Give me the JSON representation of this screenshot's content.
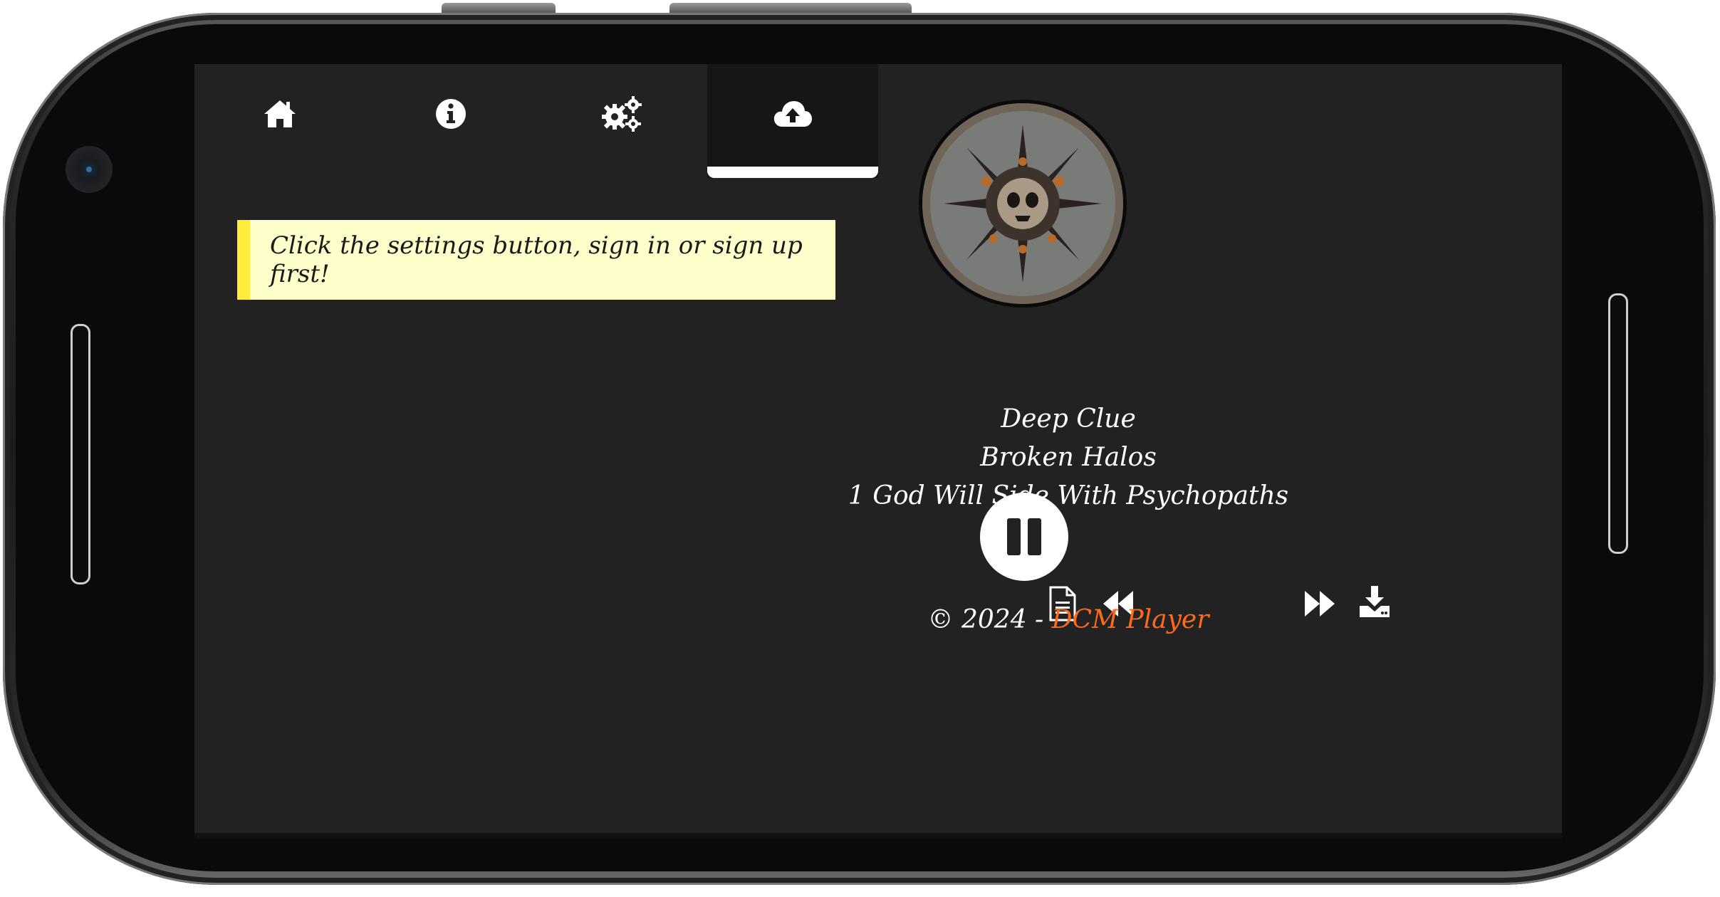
{
  "tabs": [
    {
      "name": "home",
      "icon": "home-icon",
      "active": false
    },
    {
      "name": "info",
      "icon": "info-icon",
      "active": false
    },
    {
      "name": "settings",
      "icon": "gears-icon",
      "active": false
    },
    {
      "name": "upload",
      "icon": "cloud-upload-icon",
      "active": true
    }
  ],
  "alert": {
    "message": "Click the settings button, sign in or sign up first!"
  },
  "player": {
    "artist": "Deep Clue",
    "album": "Broken Halos",
    "track": "1 God Will Side With Psychopaths",
    "controls": {
      "lyrics_icon": "document-icon",
      "prev_icon": "rewind-icon",
      "play_state": "playing",
      "pause_icon": "pause-icon",
      "next_icon": "fast-forward-icon",
      "download_icon": "download-icon"
    }
  },
  "footer": {
    "copyright": "© 2024 - ",
    "brand": "DCM Player"
  },
  "colors": {
    "background": "#222222",
    "active_tab": "#161616",
    "alert_bg": "#ffffcc",
    "alert_border": "#ffeb3b",
    "brand": "#ff6a1a"
  }
}
